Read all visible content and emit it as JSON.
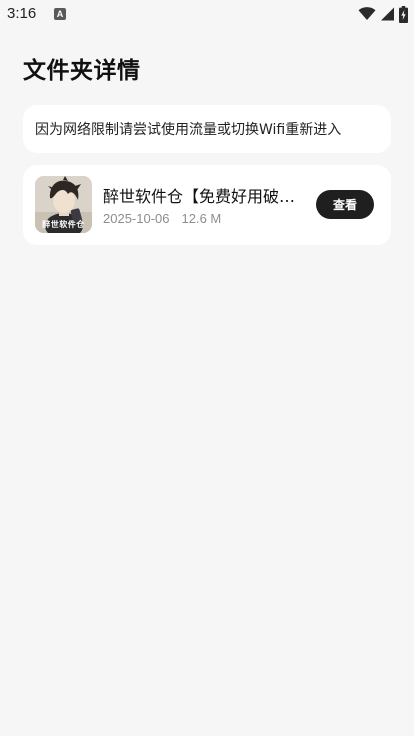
{
  "status_bar": {
    "time": "3:16",
    "notification_icon_letter": "A",
    "icons": [
      "wifi-icon",
      "signal-icon",
      "battery-charging-icon"
    ]
  },
  "page": {
    "title": "文件夹详情"
  },
  "notice": {
    "text": "因为网络限制请尝试使用流量或切换Wifi重新进入"
  },
  "files": [
    {
      "name": "醉世软件仓【免费好用破解软件】",
      "date": "2025-10-06",
      "size": "12.6 M",
      "thumb_caption": "醉世软件仓",
      "action_label": "查看"
    }
  ],
  "colors": {
    "background": "#f6f6f6",
    "card": "#ffffff",
    "button": "#1f1f1f",
    "meta_text": "#8d8d8d"
  }
}
